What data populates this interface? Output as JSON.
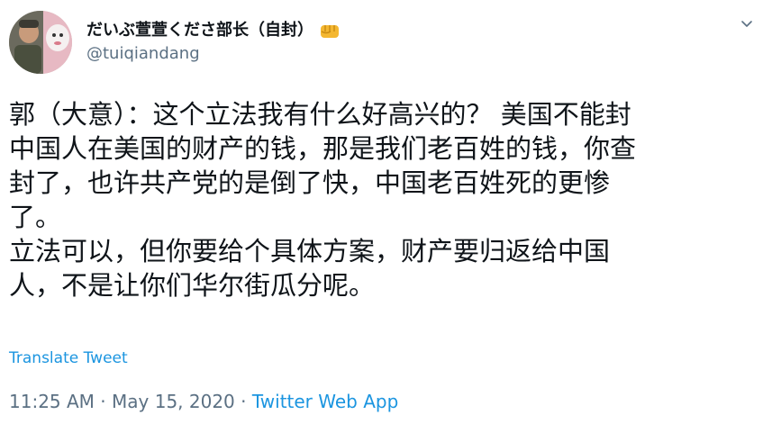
{
  "author": {
    "display_name": "だいぶ萱萱くださ部长（自封）",
    "badge_icon": "fist-emoji-icon",
    "handle": "@tuiqiandang"
  },
  "tweet": {
    "lines": [
      "郭（大意）：这个立法我有什么好高兴的？ 美国不能封",
      "中国人在美国的财产的钱，那是我们老百姓的钱，你查",
      "封了，也许共产党的是倒了快，中国老百姓死的更惨",
      "了。",
      "立法可以，但你要给个具体方案，财产要归返给中国",
      "人，不是让你们华尔街瓜分呢。"
    ],
    "translate_label": "Translate Tweet"
  },
  "meta": {
    "time": "11:25 AM",
    "separator": "·",
    "date": "May 15, 2020",
    "source": "Twitter Web App"
  },
  "colors": {
    "text": "#0f1419",
    "secondary": "#5b7083",
    "link": "#1b95e0",
    "badge": "#f4b731"
  }
}
